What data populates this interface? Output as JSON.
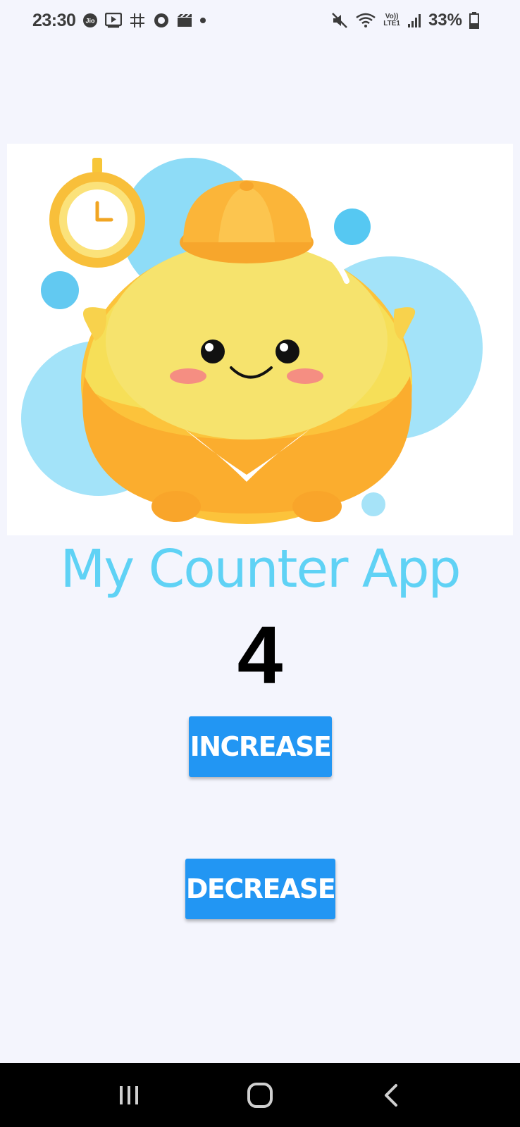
{
  "status_bar": {
    "time": "23:30",
    "battery": "33%",
    "left_icons": [
      "jio-icon",
      "video-icon",
      "grid-icon",
      "circle-icon",
      "clapper-icon",
      "dot-icon"
    ],
    "right_icons": [
      "mute-icon",
      "wifi-icon",
      "volte-icon",
      "signal-icon",
      "battery-icon"
    ],
    "volte_text": "Vo))",
    "lte_text": "LTE1"
  },
  "hero": {
    "icon": "cute-mascot-illustration"
  },
  "app": {
    "title": "My Counter App",
    "count": "4",
    "increase_label": "INCREASE",
    "decrease_label": "DECREASE"
  },
  "colors": {
    "background": "#f4f5fd",
    "title": "#5fd2f5",
    "button": "#2296f3",
    "button_text": "#ffffff"
  },
  "nav_bar": {
    "icons": [
      "recents-icon",
      "home-icon",
      "back-icon"
    ]
  }
}
